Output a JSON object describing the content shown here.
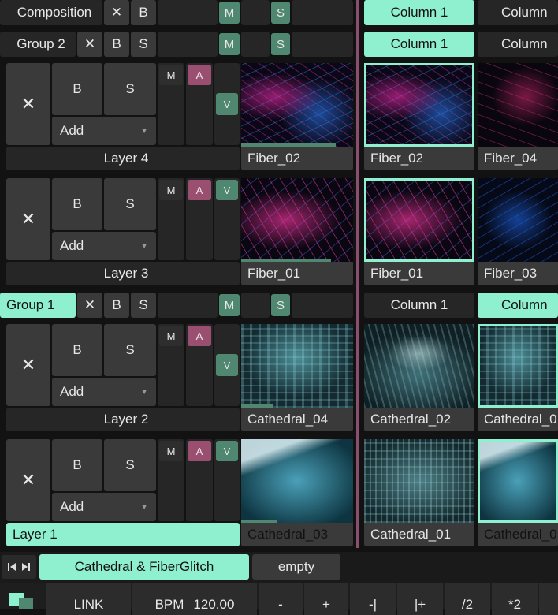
{
  "composition": {
    "label": "Composition",
    "x": "✕",
    "b": "B",
    "m": "M",
    "s": "S"
  },
  "group2": {
    "label": "Group 2",
    "x": "✕",
    "b": "B",
    "s": "S",
    "m": "M",
    "s2": "S"
  },
  "group1": {
    "label": "Group 1",
    "x": "✕",
    "b": "B",
    "s": "S",
    "m": "M",
    "s2": "S"
  },
  "columns": {
    "row1": [
      "Column 1",
      "Column"
    ],
    "row2": [
      "Column 1",
      "Column"
    ],
    "row3": [
      "Column 1",
      "Column"
    ]
  },
  "layers": [
    {
      "name": "Layer 4",
      "x": "✕",
      "b": "B",
      "s": "S",
      "add": "Add",
      "m": "M",
      "a": "A",
      "v": "V",
      "clips": [
        "Fiber_02",
        "Fiber_02",
        "Fiber_04"
      ],
      "progress": 0.8
    },
    {
      "name": "Layer 3",
      "x": "✕",
      "b": "B",
      "s": "S",
      "add": "Add",
      "m": "M",
      "a": "A",
      "v": "V",
      "clips": [
        "Fiber_01",
        "Fiber_01",
        "Fiber_03"
      ],
      "progress": 0.8
    },
    {
      "name": "Layer 2",
      "x": "✕",
      "b": "B",
      "s": "S",
      "add": "Add",
      "m": "M",
      "a": "A",
      "v": "V",
      "clips": [
        "Cathedral_04",
        "Cathedral_02",
        "Cathedral_0"
      ],
      "progress": 0.3
    },
    {
      "name": "Layer 1",
      "x": "✕",
      "b": "B",
      "s": "S",
      "add": "Add",
      "m": "M",
      "a": "A",
      "v": "V",
      "clips": [
        "Cathedral_03",
        "Cathedral_01",
        "Cathedral_0"
      ],
      "progress": 0.3
    }
  ],
  "deck": {
    "active": "Cathedral & FiberGlitch",
    "other": "empty"
  },
  "bottom": {
    "link": "LINK",
    "bpm_label": "BPM",
    "bpm_value": "120.00",
    "buttons": [
      "-",
      "+",
      "-|",
      "|+",
      "/2",
      "*2"
    ]
  },
  "colors": {
    "accent": "#8ff0cf",
    "mute_green": "#4f8770",
    "audio_purple": "#9b4f70",
    "divider": "#8a4f6d"
  }
}
